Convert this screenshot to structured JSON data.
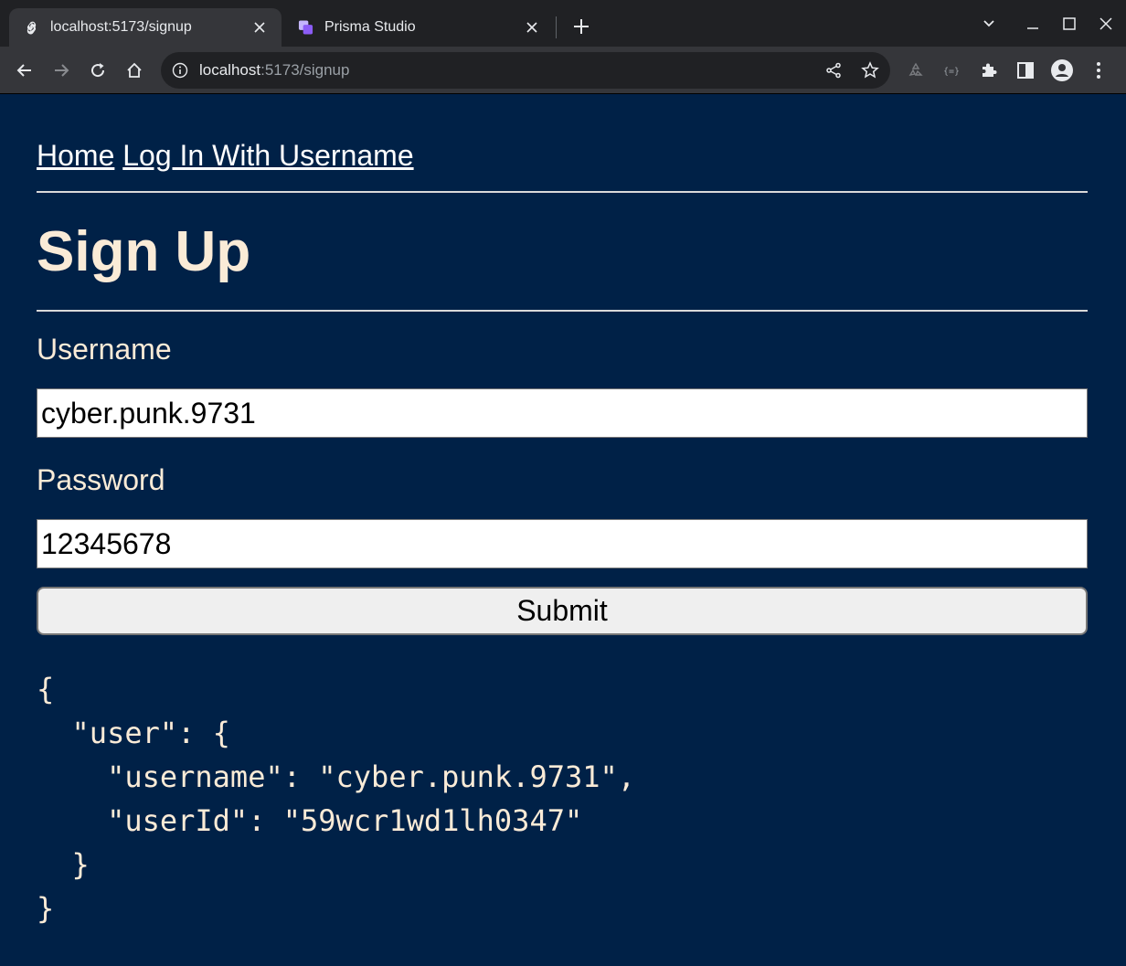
{
  "browser": {
    "tabs": [
      {
        "title": "localhost:5173/signup",
        "active": true
      },
      {
        "title": "Prisma Studio",
        "active": false
      }
    ],
    "address": {
      "host": "localhost",
      "rest": ":5173/signup"
    }
  },
  "page": {
    "nav": [
      {
        "label": "Home"
      },
      {
        "label": "Log In With Username"
      }
    ],
    "heading": "Sign Up",
    "form": {
      "username_label": "Username",
      "username_value": "cyber.punk.9731",
      "password_label": "Password",
      "password_value": "12345678",
      "submit_label": "Submit"
    },
    "json_lines": [
      "{",
      "  \"user\": {",
      "    \"username\": \"cyber.punk.9731\",",
      "    \"userId\": \"59wcr1wd1lh0347\"",
      "  }",
      "}"
    ]
  },
  "colors": {
    "page_bg": "#002147",
    "text": "#faebd7",
    "link": "#ffffff",
    "chrome_dark": "#202124",
    "chrome_toolbar": "#35363a"
  }
}
